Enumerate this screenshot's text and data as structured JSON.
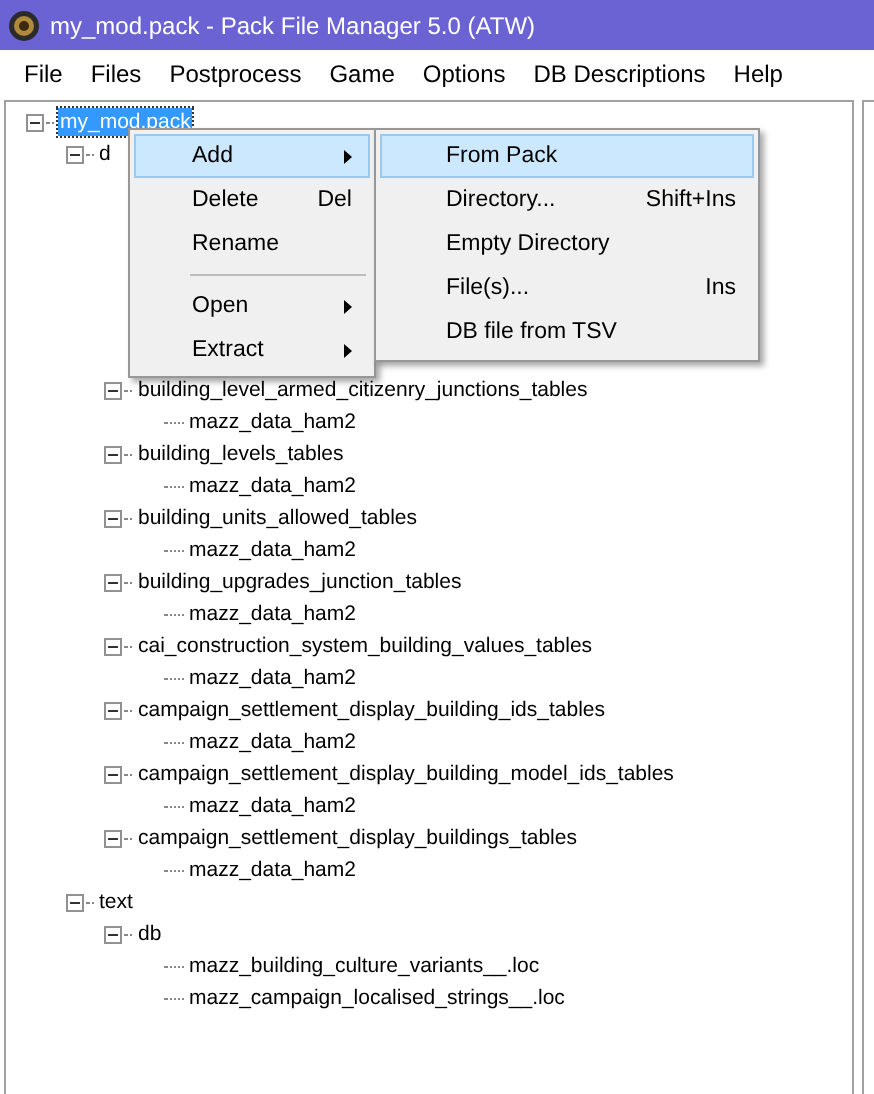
{
  "window": {
    "title": "my_mod.pack - Pack File Manager 5.0 (ATW)"
  },
  "menu_bar": [
    "File",
    "Files",
    "Postprocess",
    "Game",
    "Options",
    "DB Descriptions",
    "Help"
  ],
  "tree": [
    {
      "label": "my_mod.pack",
      "selected": true,
      "expanded": true,
      "children": [
        {
          "label": "d",
          "selected": false,
          "expanded": true,
          "children": [
            {
              "label": "building_level_armed_citizenry_junctions_tables",
              "selected": false,
              "expanded": true,
              "children": [
                {
                  "label": "mazz_data_ham2",
                  "selected": false
                }
              ]
            },
            {
              "label": "building_levels_tables",
              "selected": false,
              "expanded": true,
              "children": [
                {
                  "label": "mazz_data_ham2",
                  "selected": false
                }
              ]
            },
            {
              "label": "building_units_allowed_tables",
              "selected": false,
              "expanded": true,
              "children": [
                {
                  "label": "mazz_data_ham2",
                  "selected": false
                }
              ]
            },
            {
              "label": "building_upgrades_junction_tables",
              "selected": false,
              "expanded": true,
              "children": [
                {
                  "label": "mazz_data_ham2",
                  "selected": false
                }
              ]
            },
            {
              "label": "cai_construction_system_building_values_tables",
              "selected": false,
              "expanded": true,
              "children": [
                {
                  "label": "mazz_data_ham2",
                  "selected": false
                }
              ]
            },
            {
              "label": "campaign_settlement_display_building_ids_tables",
              "selected": false,
              "expanded": true,
              "children": [
                {
                  "label": "mazz_data_ham2",
                  "selected": false
                }
              ]
            },
            {
              "label": "campaign_settlement_display_building_model_ids_tables",
              "selected": false,
              "expanded": true,
              "children": [
                {
                  "label": "mazz_data_ham2",
                  "selected": false
                }
              ]
            },
            {
              "label": "campaign_settlement_display_buildings_tables",
              "selected": false,
              "expanded": true,
              "children": [
                {
                  "label": "mazz_data_ham2",
                  "selected": false
                }
              ]
            }
          ]
        },
        {
          "label": "text",
          "selected": false,
          "expanded": true,
          "children": [
            {
              "label": "db",
              "selected": false,
              "expanded": true,
              "children": [
                {
                  "label": "mazz_building_culture_variants__.loc",
                  "selected": false
                },
                {
                  "label": "mazz_campaign_localised_strings__.loc",
                  "selected": false
                }
              ]
            }
          ]
        }
      ]
    }
  ],
  "context_menu": {
    "items": [
      {
        "kind": "item",
        "label": "Add",
        "submenu": true,
        "selected": true
      },
      {
        "kind": "item",
        "label": "Delete",
        "shortcut": "Del",
        "submenu": false,
        "selected": false
      },
      {
        "kind": "item",
        "label": "Rename",
        "submenu": false,
        "selected": false
      },
      {
        "kind": "separator"
      },
      {
        "kind": "item",
        "label": "Open",
        "submenu": true,
        "selected": false
      },
      {
        "kind": "item",
        "label": "Extract",
        "submenu": true,
        "selected": false
      }
    ]
  },
  "submenu": {
    "items": [
      {
        "label": "From Pack",
        "selected": true
      },
      {
        "label": "Directory...",
        "shortcut": "Shift+Ins",
        "selected": false
      },
      {
        "label": "Empty Directory",
        "selected": false
      },
      {
        "label": "File(s)...",
        "shortcut": "Ins",
        "selected": false
      },
      {
        "label": "DB file from TSV",
        "selected": false
      }
    ]
  }
}
